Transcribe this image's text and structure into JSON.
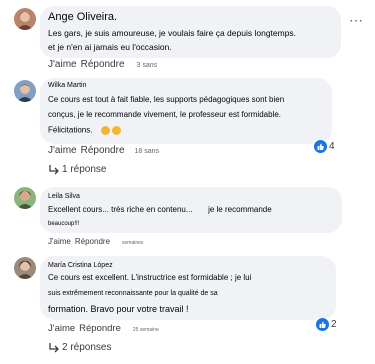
{
  "comments": [
    {
      "name": "Ange Oliveira.",
      "lines": [
        "Les gars, je suis amoureuse, je voulais faire ça depuis longtemps.",
        "et je n'en ai jamais eu l'occasion."
      ],
      "like_label": "J'aime",
      "reply_label": "Répondre",
      "time": "3 sans",
      "more_icon": "more-dots-icon"
    },
    {
      "name": "Wilka Martin",
      "lines": [
        "Ce cours est tout à fait fiable, les supports pédagogiques sont bien",
        "conçus, je le recommande vivement, le professeur est formidable.",
        "Félicitations."
      ],
      "like_label": "J'aime",
      "reply_label": "Répondre",
      "time": "18 sans",
      "reaction_count": "4",
      "replies_label": "1 réponse"
    },
    {
      "name": "Leila Silva",
      "lines": [
        "Excellent cours... très riche en contenu...       je le recommande",
        "beaucoup!!!"
      ],
      "like_label": "J'aime",
      "reply_label": "Répondre",
      "time": "semaines"
    },
    {
      "name": "María Cristina López",
      "lines": [
        "Ce cours est excellent. L'instructrice est formidable ; je lui",
        "suis extrêmement reconnaissante pour la qualité de sa",
        "formation. Bravo pour votre travail !"
      ],
      "like_label": "J'aime",
      "reply_label": "Répondre",
      "time": "25 semaine",
      "reaction_count": "2",
      "replies_label": "2 réponses"
    }
  ],
  "colors": {
    "bubble": "#f0f2f5",
    "like_blue": "#1b74e4",
    "text": "#050505",
    "meta": "#65676b"
  }
}
